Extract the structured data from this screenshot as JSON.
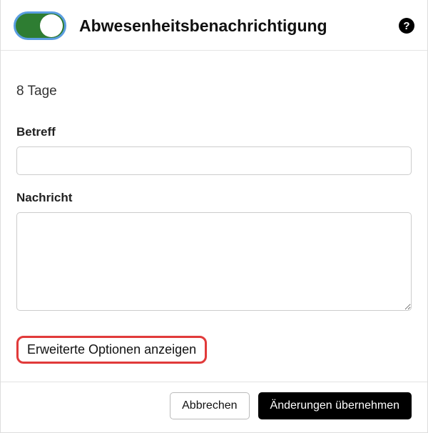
{
  "header": {
    "title": "Abwesenheitsbenachrichtigung",
    "toggle_on": true
  },
  "form": {
    "days_text": "8 Tage",
    "subject_label": "Betreff",
    "subject_value": "",
    "message_label": "Nachricht",
    "message_value": ""
  },
  "advanced": {
    "toggle_label": "Erweiterte Optionen anzeigen"
  },
  "footer": {
    "cancel_label": "Abbrechen",
    "save_label": "Änderungen übernehmen"
  },
  "icons": {
    "help_glyph": "?"
  }
}
